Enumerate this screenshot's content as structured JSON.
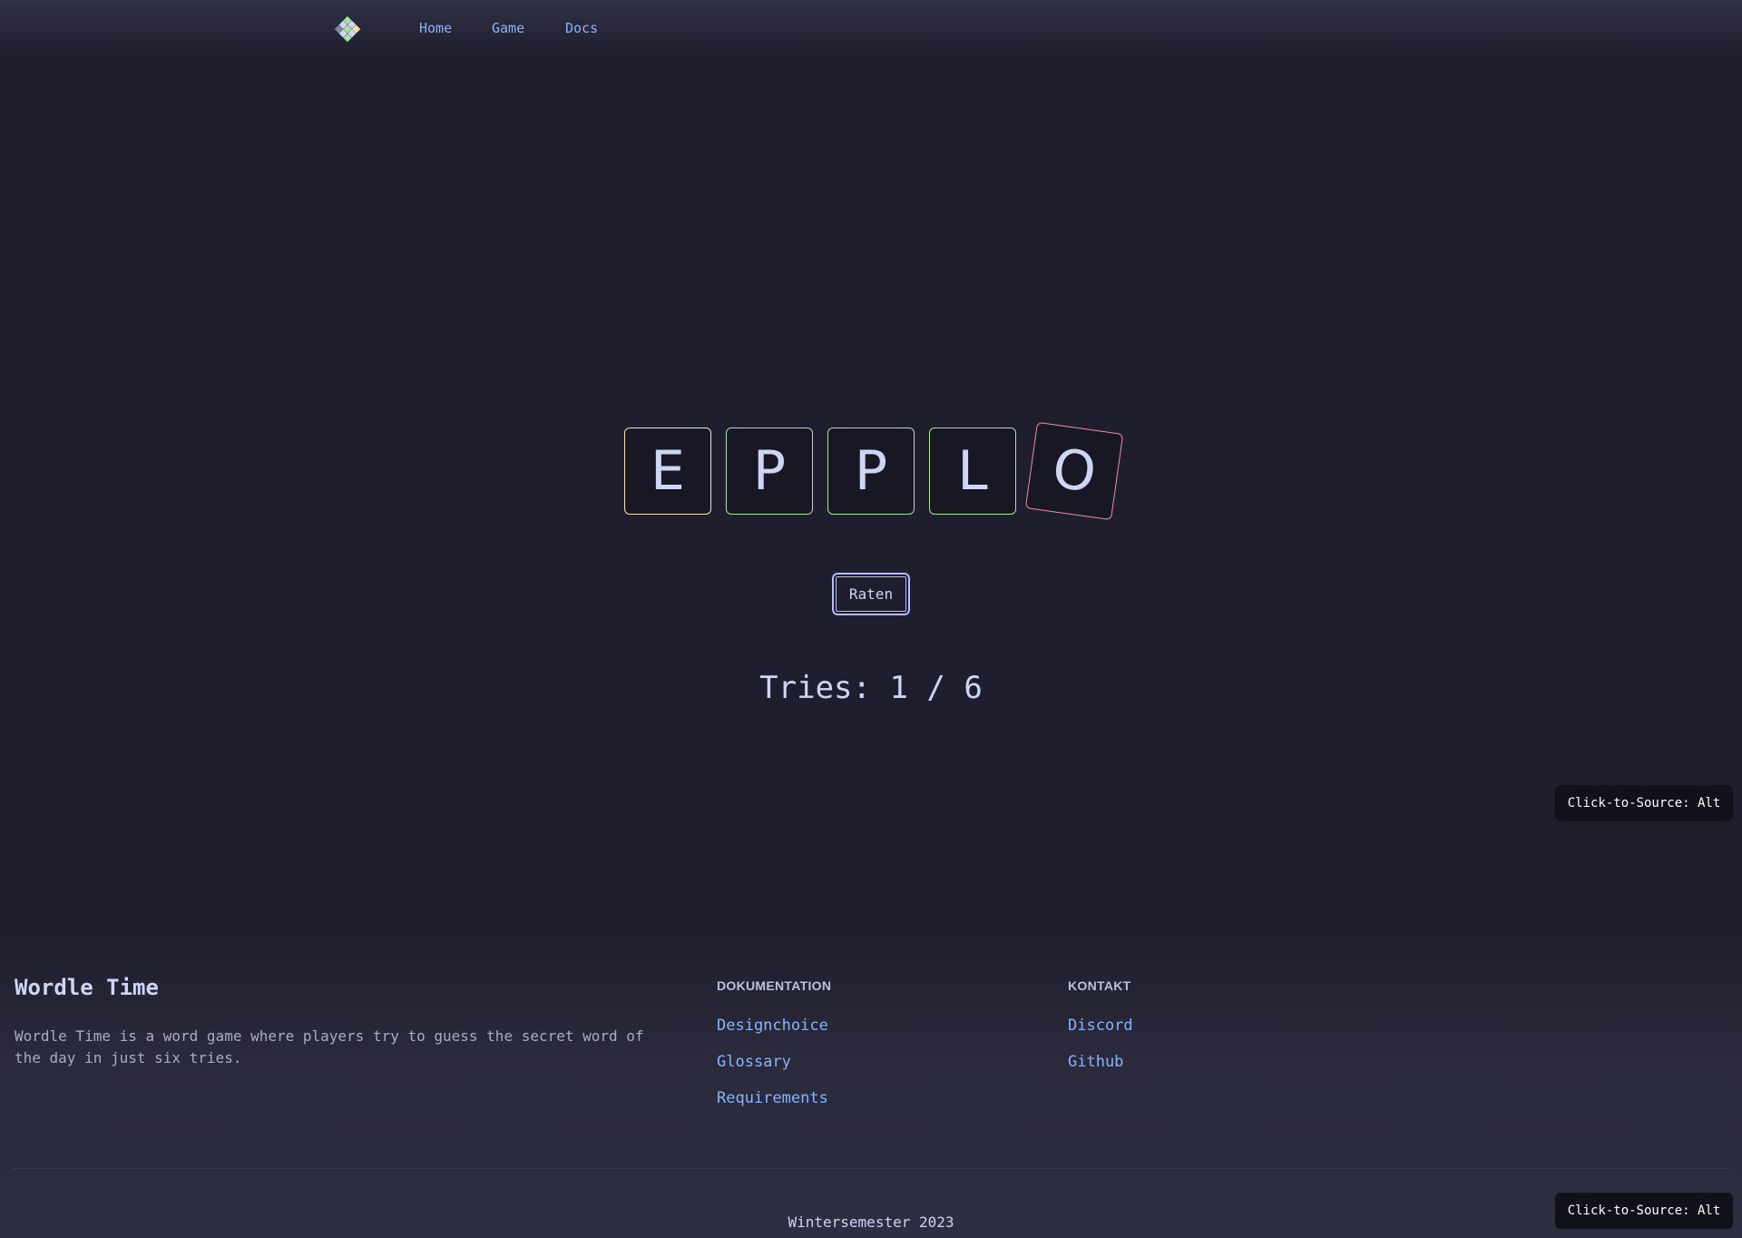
{
  "nav": {
    "logo_icon": "wordle-grid-logo",
    "links": [
      {
        "label": "Home"
      },
      {
        "label": "Game"
      },
      {
        "label": "Docs"
      }
    ]
  },
  "game": {
    "tiles": [
      {
        "letter": "E",
        "state": "present",
        "color": "#f9e2af"
      },
      {
        "letter": "P",
        "state": "correct",
        "color": "#a6e3a1"
      },
      {
        "letter": "P",
        "state": "correct",
        "color": "#a6e3a1"
      },
      {
        "letter": "L",
        "state": "correct",
        "color": "#a6e3a1"
      },
      {
        "letter": "O",
        "state": "active",
        "color": "#f38ba8"
      }
    ],
    "guess_button": "Raten",
    "tries_text": "Tries: 1 / 6",
    "tries_current": 1,
    "tries_max": 6
  },
  "overlay": {
    "click_to_source": "Click-to-Source: Alt"
  },
  "footer": {
    "title": "Wordle Time",
    "description": "Wordle Time is a word game where players try to guess the secret word of the day in just six tries.",
    "docs_heading": "DOKUMENTATION",
    "docs_links": [
      "Designchoice",
      "Glossary",
      "Requirements"
    ],
    "contact_heading": "KONTAKT",
    "contact_links": [
      "Discord",
      "Github"
    ],
    "semester": "Wintersemester 2023"
  },
  "colors": {
    "background": "#1e1e2e",
    "link": "#89b4fa",
    "present": "#f9e2af",
    "correct": "#a6e3a1",
    "active": "#f38ba8"
  }
}
